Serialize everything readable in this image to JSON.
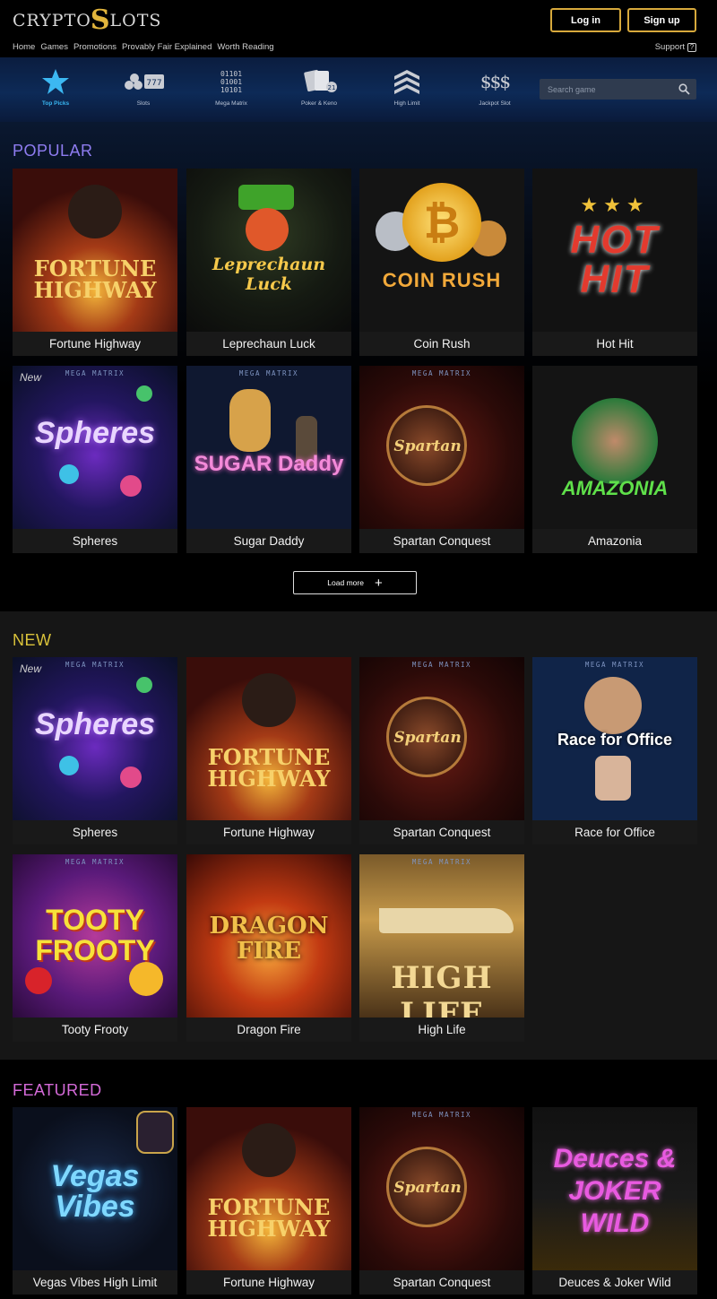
{
  "header": {
    "logo_left": "CRYPTO",
    "logo_dollar": "S",
    "logo_right": "LOTS",
    "login_label": "Log in",
    "signup_label": "Sign up",
    "nav": [
      "Home",
      "Games",
      "Promotions",
      "Provably Fair Explained",
      "Worth Reading"
    ],
    "support_label": "Support"
  },
  "categories": [
    {
      "label": "Top Picks",
      "icon": "star-icon",
      "active": true
    },
    {
      "label": "Slots",
      "icon": "slots-icon",
      "active": false
    },
    {
      "label": "Mega Matrix",
      "icon": "matrix-icon",
      "active": false
    },
    {
      "label": "Poker & Keno",
      "icon": "cards-icon",
      "active": false
    },
    {
      "label": "High Limit",
      "icon": "high-limit-icon",
      "active": false
    },
    {
      "label": "Jackpot Slot",
      "icon": "jackpot-icon",
      "active": false
    }
  ],
  "matrix_icon_text": [
    "01101",
    "01001",
    "10101"
  ],
  "jackpot_icon_text": "$$$",
  "search": {
    "placeholder": "Search game"
  },
  "popular": {
    "title": "POPULAR",
    "games": [
      {
        "name": "Fortune Highway",
        "art": "FORTUNE HIGHWAY"
      },
      {
        "name": "Leprechaun Luck",
        "art": "Leprechaun Luck"
      },
      {
        "name": "Coin Rush",
        "art": "COIN RUSH"
      },
      {
        "name": "Hot Hit",
        "art": "HOT HIT"
      },
      {
        "name": "Spheres",
        "art": "Spheres",
        "tag": "New",
        "mega": "MEGA MATRIX"
      },
      {
        "name": "Sugar Daddy",
        "art": "SUGAR Daddy",
        "mega": "MEGA MATRIX"
      },
      {
        "name": "Spartan Conquest",
        "art": "Spartan",
        "mega": "MEGA MATRIX"
      },
      {
        "name": "Amazonia",
        "art": "AMAZONIA"
      }
    ],
    "load_more_label": "Load more"
  },
  "new_section": {
    "title": "NEW",
    "games": [
      {
        "name": "Spheres",
        "art": "Spheres",
        "tag": "New",
        "mega": "MEGA MATRIX"
      },
      {
        "name": "Fortune Highway",
        "art": "FORTUNE HIGHWAY"
      },
      {
        "name": "Spartan Conquest",
        "art": "Spartan",
        "mega": "MEGA MATRIX"
      },
      {
        "name": "Race for Office",
        "art": "Race for Office",
        "mega": "MEGA MATRIX"
      },
      {
        "name": "Tooty Frooty",
        "art": "TOOTY FROOTY",
        "mega": "MEGA MATRIX"
      },
      {
        "name": "Dragon Fire",
        "art": "DRAGON FIRE"
      },
      {
        "name": "High Life",
        "art": "HIGH LIFE",
        "mega": "MEGA MATRIX"
      }
    ]
  },
  "featured": {
    "title": "FEATURED",
    "games": [
      {
        "name": "Vegas Vibes High Limit",
        "art": "Vegas Vibes"
      },
      {
        "name": "Fortune Highway",
        "art": "FORTUNE HIGHWAY"
      },
      {
        "name": "Spartan Conquest",
        "art": "Spartan",
        "mega": "MEGA MATRIX"
      },
      {
        "name": "Deuces & Joker Wild",
        "art": "Deuces & JOKER WILD"
      }
    ]
  },
  "colors": {
    "gold": "#d7a93c",
    "popular_title": "#8e7cf0",
    "new_title": "#d9c23a",
    "featured_title": "#d46ad8",
    "active_category": "#39b6f0"
  }
}
